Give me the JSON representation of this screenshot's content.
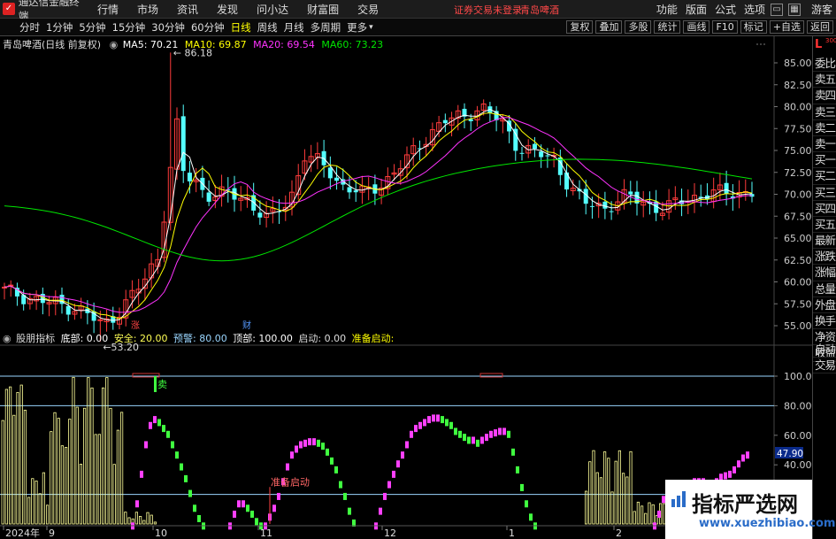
{
  "menubar": {
    "app_name": "通达信金融终端",
    "items": [
      "行情",
      "市场",
      "资讯",
      "发现",
      "问小达",
      "财富圈",
      "交易"
    ],
    "notice": "证券交易未登录",
    "stock_title": "青岛啤酒",
    "right_items": [
      "功能",
      "版面",
      "公式",
      "选项"
    ],
    "user": "游客"
  },
  "toolbar": {
    "periods": [
      "分时",
      "1分钟",
      "5分钟",
      "15分钟",
      "30分钟",
      "60分钟",
      "日线",
      "周线",
      "月线",
      "多周期",
      "更多"
    ],
    "active_period": "日线",
    "right_buttons": [
      "复权",
      "叠加",
      "多股",
      "统计",
      "画线",
      "F10",
      "标记",
      "+自选",
      "返回"
    ]
  },
  "sidepanel": {
    "badge": "L",
    "badge_num": "300",
    "items": [
      "委比",
      "卖五",
      "卖四",
      "卖三",
      "卖二",
      "卖一",
      "买一",
      "买二",
      "买三",
      "买四",
      "买五",
      "最新",
      "涨跌",
      "涨幅",
      "总量",
      "外盘",
      "换手",
      "净资",
      "收益"
    ],
    "trade": [
      "自动",
      "交易"
    ]
  },
  "main_legend": {
    "title": "青岛啤酒(日线 前复权)",
    "ma5": "MA5: 70.21",
    "ma10": "MA10: 69.87",
    "ma20": "MA20: 69.54",
    "ma60": "MA60: 73.23"
  },
  "price_axis": {
    "ticks": [
      "85.00",
      "82.50",
      "80.00",
      "77.50",
      "75.00",
      "72.50",
      "70.00",
      "67.50",
      "65.00",
      "62.50",
      "60.00",
      "57.50",
      "55.00"
    ],
    "high_label": "86.18",
    "low_label": "53.20",
    "event_marks": [
      "涨",
      "财"
    ]
  },
  "indicator_legend": {
    "name": "股朋指标",
    "bottom": "底部: 0.00",
    "safe": "安全: 20.00",
    "warn": "预警: 80.00",
    "top": "顶部: 100.00",
    "start": "启动: 0.00",
    "prepare": "准备启动:"
  },
  "indicator_axis": {
    "ticks": [
      "100.00",
      "80.00",
      "60.00",
      "40.00"
    ],
    "current": "47.90",
    "sell_mark": "卖",
    "prepare_mark": "准备启动"
  },
  "date_axis": {
    "labels": [
      "2024年",
      "9",
      "10",
      "11",
      "12",
      "1",
      "2"
    ]
  },
  "watermark": {
    "line1": "指标严选网",
    "line2": "www.xuezhibiao.com"
  },
  "colors": {
    "up": "#ff3c3c",
    "down": "#54ffff",
    "ma5": "#ffffff",
    "ma10": "#ffff00",
    "ma20": "#ff33ff",
    "ma60": "#00e600",
    "pink_bar": "#ff40ff",
    "green_bar": "#40ff40",
    "volume_bar": "#ffff99"
  }
}
